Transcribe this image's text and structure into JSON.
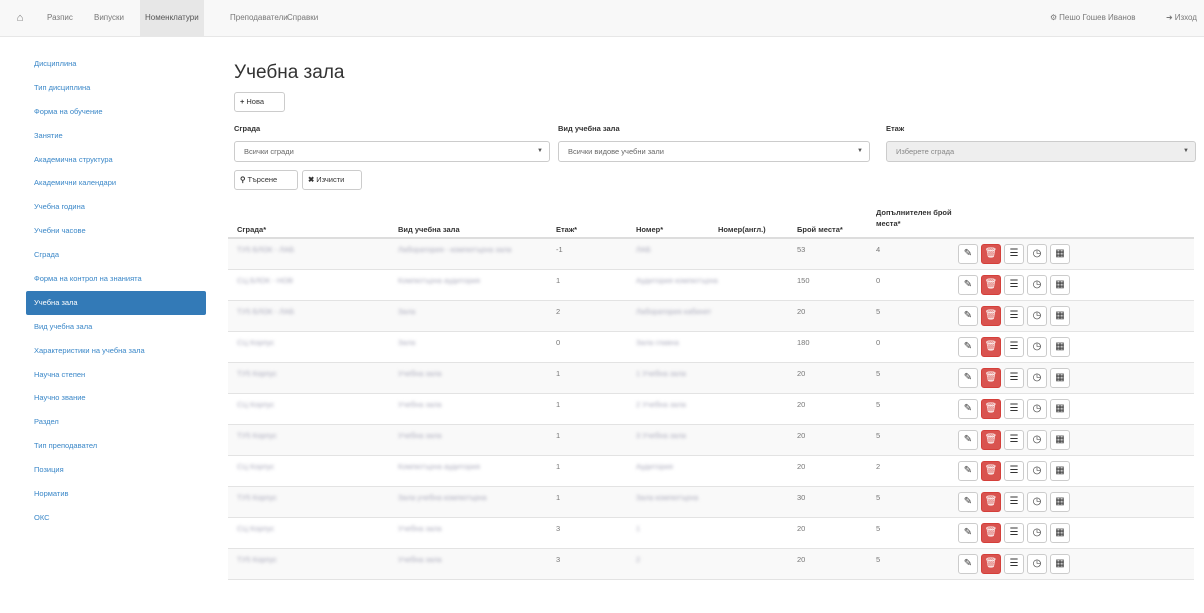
{
  "nav": {
    "home_icon": "home-icon",
    "items": [
      "Разпис",
      "Випуски",
      "Номенклатури",
      "Преподаватели",
      "Справки"
    ],
    "active": "Номенклатури",
    "user": "Пешо Гошев Иванов",
    "logout": "Изход"
  },
  "sidebar": {
    "items": [
      "Дисциплина",
      "Тип дисциплина",
      "Форма на обучение",
      "Занятие",
      "Академична структура",
      "Академични календари",
      "Учебна година",
      "Учебни часове",
      "Сграда",
      "Форма на контрол на знанията",
      "Учебна зала",
      "Вид учебна зала",
      "Характеристики на учебна зала",
      "Научна степен",
      "Научно звание",
      "Раздел",
      "Тип преподавател",
      "Позиция",
      "Норматив",
      "ОКС"
    ],
    "active_index": 10
  },
  "page": {
    "title": "Учебна зала",
    "new_button": "Нова",
    "search_button": "Търсене",
    "clear_button": "Изчисти"
  },
  "filters": {
    "building_label": "Сграда",
    "building_value": "Всички сгради",
    "hall_type_label": "Вид учебна зала",
    "hall_type_value": "Всички видове учебни зали",
    "floor_label": "Етаж",
    "floor_value": "Изберете сграда"
  },
  "table": {
    "headers": [
      "Сграда*",
      "Вид учебна зала",
      "Етаж*",
      "Номер*",
      "Номер(англ.)",
      "Брой места*",
      "Допълнителен брой места*"
    ],
    "rows": [
      {
        "building": "ТУ5 БЛОК - ЛАБ",
        "type": "Лаборатория - компютърна зала",
        "floor": "-1",
        "number": "ЛАБ",
        "number_en": "",
        "seats": "53",
        "extra": "4"
      },
      {
        "building": "СЦ БЛОК - НОВ",
        "type": "Компютърна аудитория",
        "floor": "1",
        "number": "Аудитория компютърна",
        "number_en": "",
        "seats": "150",
        "extra": "0"
      },
      {
        "building": "ТУ5 БЛОК - ЛАБ",
        "type": "Зала",
        "floor": "2",
        "number": "Лаборатория кабинет",
        "number_en": "",
        "seats": "20",
        "extra": "5"
      },
      {
        "building": "СЦ Корпус",
        "type": "Зала",
        "floor": "0",
        "number": "Зала главна",
        "number_en": "",
        "seats": "180",
        "extra": "0"
      },
      {
        "building": "ТУ5 Корпус",
        "type": "Учебна зала",
        "floor": "1",
        "number": "1 Учебна зала",
        "number_en": "",
        "seats": "20",
        "extra": "5"
      },
      {
        "building": "СЦ Корпус",
        "type": "Учебна зала",
        "floor": "1",
        "number": "2 Учебна зала",
        "number_en": "",
        "seats": "20",
        "extra": "5"
      },
      {
        "building": "ТУ5 Корпус",
        "type": "Учебна зала",
        "floor": "1",
        "number": "3 Учебна зала",
        "number_en": "",
        "seats": "20",
        "extra": "5"
      },
      {
        "building": "СЦ Корпус",
        "type": "Компютърна аудитория",
        "floor": "1",
        "number": "Аудитория",
        "number_en": "",
        "seats": "20",
        "extra": "2"
      },
      {
        "building": "ТУ5 Корпус",
        "type": "Зала учебна компютърна",
        "floor": "1",
        "number": "Зала компютърна",
        "number_en": "",
        "seats": "30",
        "extra": "5"
      },
      {
        "building": "СЦ Корпус",
        "type": "Учебна зала",
        "floor": "3",
        "number": "1",
        "number_en": "",
        "seats": "20",
        "extra": "5"
      },
      {
        "building": "ТУ5 Корпус",
        "type": "Учебна зала",
        "floor": "3",
        "number": "2",
        "number_en": "",
        "seats": "20",
        "extra": "5"
      }
    ]
  },
  "icons": {
    "edit": "pencil-icon",
    "delete": "trash-icon",
    "list": "list-icon",
    "schedule": "clock-icon",
    "calendar": "calendar-icon"
  },
  "colors": {
    "accent": "#337ab7",
    "danger": "#d9534f"
  }
}
